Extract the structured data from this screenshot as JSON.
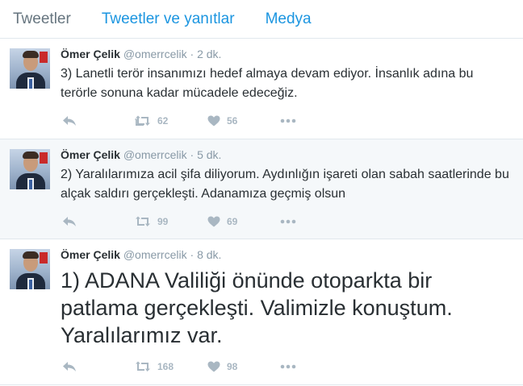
{
  "tabs": [
    {
      "label": "Tweetler",
      "active": true
    },
    {
      "label": "Tweetler ve yanıtlar",
      "active": false
    },
    {
      "label": "Medya",
      "active": false
    }
  ],
  "tweets": [
    {
      "name": "Ömer Çelik",
      "handle": "@omerrcelik",
      "separator": "·",
      "time": "2 dk.",
      "text": "3) Lanetli terör insanımızı hedef almaya devam ediyor. İnsanlık adına bu terörle sonuna kadar mücadele edeceğiz.",
      "retweets": "62",
      "likes": "56"
    },
    {
      "name": "Ömer Çelik",
      "handle": "@omerrcelik",
      "separator": "·",
      "time": "5 dk.",
      "text": "2) Yaralılarımıza acil şifa diliyorum. Aydınlığın işareti olan sabah saatlerinde bu alçak saldırı gerçekleşti. Adanamıza geçmiş olsun",
      "retweets": "99",
      "likes": "69"
    },
    {
      "name": "Ömer Çelik",
      "handle": "@omerrcelik",
      "separator": "·",
      "time": "8 dk.",
      "text": "1) ADANA Valiliği önünde otoparkta  bir patlama gerçekleşti. Valimizle konuştum. Yaralılarımız var.",
      "retweets": "168",
      "likes": "98"
    }
  ],
  "icons": {
    "reply": "reply-icon",
    "retweet": "retweet-icon",
    "like": "heart-icon",
    "more": "more-icon",
    "avatar": "profile-photo"
  },
  "colors": {
    "link": "#1b95e0",
    "muted": "#8899a6",
    "action": "#a9b7c2",
    "highlight_bg": "#f5f8fa"
  }
}
